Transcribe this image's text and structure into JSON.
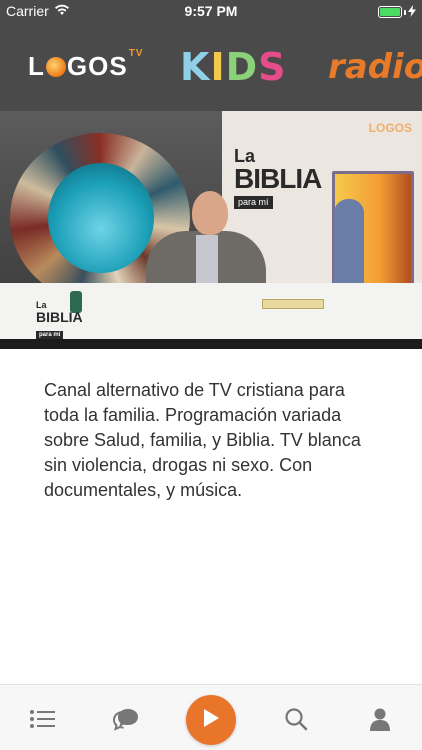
{
  "status_bar": {
    "carrier": "Carrier",
    "time": "9:57 PM",
    "icons": [
      "wifi-icon",
      "battery-icon",
      "charging-icon"
    ]
  },
  "channels": {
    "logos": {
      "name": "LOGOS",
      "badge": "TV"
    },
    "kids": {
      "letters": [
        "K",
        "I",
        "D",
        "S"
      ],
      "colors": [
        "#8fd0e8",
        "#f2c94c",
        "#8ad17a",
        "#e64c8a"
      ]
    },
    "radio": {
      "name": "radio"
    }
  },
  "video": {
    "panel_title_line1": "La",
    "panel_title_line2": "BIBLIA",
    "panel_title_line3": "para mí",
    "corner_logo": "LOGOS",
    "lower_logo_line1": "La",
    "lower_logo_line2": "BIBLIA",
    "lower_logo_line3": "para mí"
  },
  "description": "Canal alternativo de TV cristiana para toda la familia. Programación variada sobre Salud, familia, y Biblia. TV blanca sin violencia, drogas ni sexo. Con documentales, y música.",
  "tab_bar": {
    "icons": [
      "list-icon",
      "chat-bubble-icon",
      "play-icon",
      "search-icon",
      "profile-icon"
    ],
    "accent": "#e8752a",
    "icon_color": "#777777"
  }
}
